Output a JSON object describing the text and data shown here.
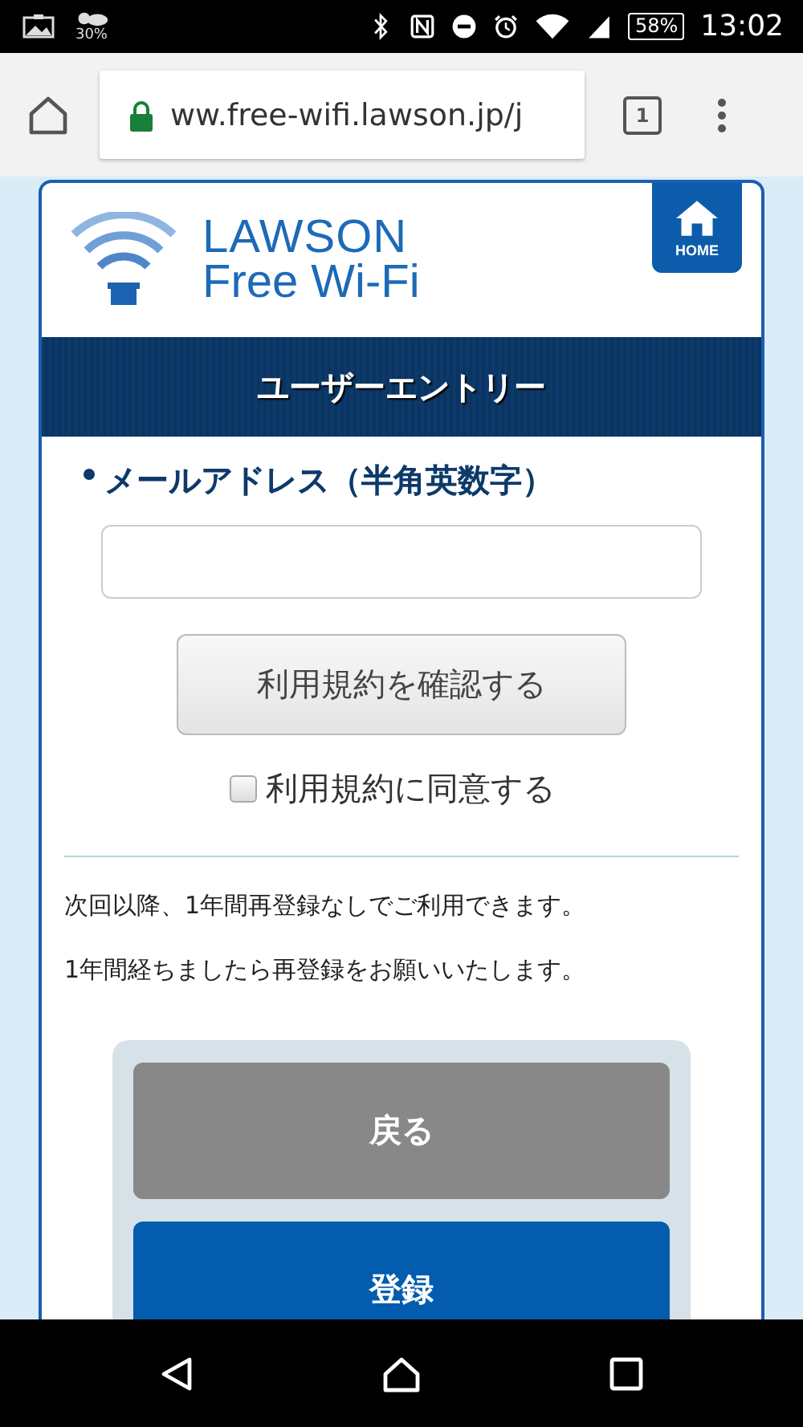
{
  "status_bar": {
    "weather_percent": "30%",
    "battery": "58%",
    "time": "13:02"
  },
  "browser": {
    "url": "ww.free-wifi.lawson.jp/j",
    "tab_count": "1"
  },
  "header": {
    "logo_line_1": "LAWSON",
    "logo_line_2": "Free Wi-Fi",
    "home_button": "HOME"
  },
  "title": "ユーザーエントリー",
  "form": {
    "email_label": "メールアドレス（半角英数字）",
    "terms_button": "利用規約を確認する",
    "agree": {
      "label": "利用規約に同意する",
      "checked": false
    }
  },
  "notes": [
    "次回以降、1年間再登録なしでご利用できます。",
    "1年間経ちましたら再登録をお願いいたします。"
  ],
  "actions": [
    {
      "label": "戻る",
      "kind": "back"
    },
    {
      "label": "登録",
      "kind": "primary"
    }
  ]
}
